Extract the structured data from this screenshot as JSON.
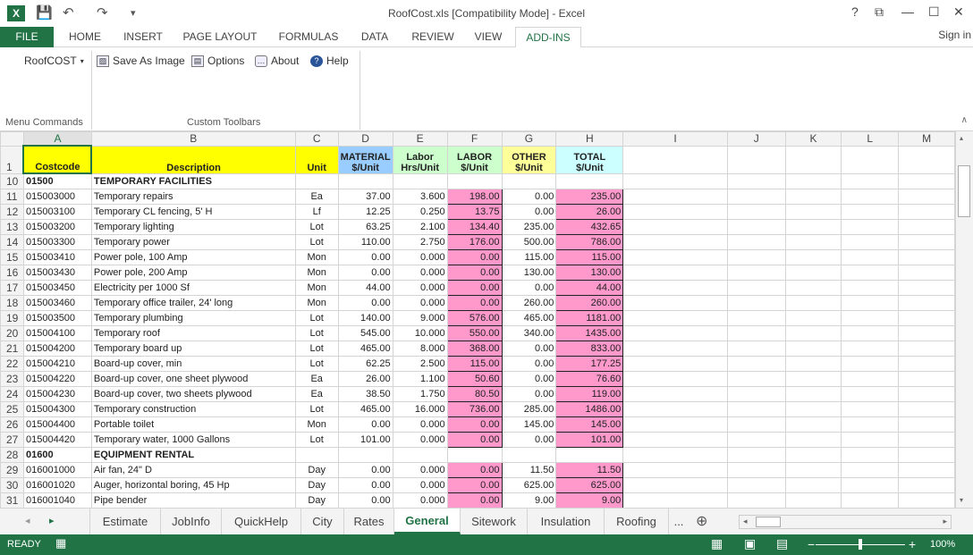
{
  "window": {
    "title": "RoofCost.xls  [Compatibility Mode] - Excel",
    "help": "?",
    "restore": "⧉",
    "minimize": "—",
    "maximize": "☐",
    "close": "✕",
    "app_icon": "X",
    "undo": "↶",
    "redo": "↷",
    "save": "💾",
    "customize": "▾"
  },
  "tabs": [
    "FILE",
    "HOME",
    "INSERT",
    "PAGE LAYOUT",
    "FORMULAS",
    "DATA",
    "REVIEW",
    "VIEW",
    "ADD-INS"
  ],
  "signin": "Sign in",
  "ribbon": {
    "roofcost": "RoofCOST",
    "save_image": "Save As Image",
    "options": "Options",
    "about": "About",
    "help": "Help",
    "menu_commands": "Menu Commands",
    "custom_toolbars": "Custom Toolbars"
  },
  "columns": [
    "A",
    "B",
    "C",
    "D",
    "E",
    "F",
    "G",
    "H",
    "I",
    "J",
    "K",
    "L",
    "M"
  ],
  "header": {
    "row": "1",
    "a": "Costcode",
    "b": "Description",
    "c": "Unit",
    "d1": "MATERIAL",
    "d2": "$/Unit",
    "e1": "Labor",
    "e2": "Hrs/Unit",
    "f1": "LABOR",
    "f2": "$/Unit",
    "g1": "OTHER",
    "g2": "$/Unit",
    "h1": "TOTAL",
    "h2": "$/Unit"
  },
  "rows": [
    {
      "r": "10",
      "a": "01500",
      "b": "TEMPORARY FACILITIES",
      "c": "",
      "d": "",
      "e": "",
      "f": "",
      "g": "",
      "h": "",
      "sec": true
    },
    {
      "r": "11",
      "a": "015003000",
      "b": "Temporary repairs",
      "c": "Ea",
      "d": "37.00",
      "e": "3.600",
      "f": "198.00",
      "g": "0.00",
      "h": "235.00"
    },
    {
      "r": "12",
      "a": "015003100",
      "b": "Temporary CL fencing, 5' H",
      "c": "Lf",
      "d": "12.25",
      "e": "0.250",
      "f": "13.75",
      "g": "0.00",
      "h": "26.00"
    },
    {
      "r": "13",
      "a": "015003200",
      "b": "Temporary lighting",
      "c": "Lot",
      "d": "63.25",
      "e": "2.100",
      "f": "134.40",
      "g": "235.00",
      "h": "432.65"
    },
    {
      "r": "14",
      "a": "015003300",
      "b": "Temporary power",
      "c": "Lot",
      "d": "110.00",
      "e": "2.750",
      "f": "176.00",
      "g": "500.00",
      "h": "786.00"
    },
    {
      "r": "15",
      "a": "015003410",
      "b": "Power pole, 100 Amp",
      "c": "Mon",
      "d": "0.00",
      "e": "0.000",
      "f": "0.00",
      "g": "115.00",
      "h": "115.00"
    },
    {
      "r": "16",
      "a": "015003430",
      "b": "Power pole, 200 Amp",
      "c": "Mon",
      "d": "0.00",
      "e": "0.000",
      "f": "0.00",
      "g": "130.00",
      "h": "130.00"
    },
    {
      "r": "17",
      "a": "015003450",
      "b": "Electricity per 1000 Sf",
      "c": "Mon",
      "d": "44.00",
      "e": "0.000",
      "f": "0.00",
      "g": "0.00",
      "h": "44.00"
    },
    {
      "r": "18",
      "a": "015003460",
      "b": "Temporary office trailer, 24' long",
      "c": "Mon",
      "d": "0.00",
      "e": "0.000",
      "f": "0.00",
      "g": "260.00",
      "h": "260.00"
    },
    {
      "r": "19",
      "a": "015003500",
      "b": "Temporary plumbing",
      "c": "Lot",
      "d": "140.00",
      "e": "9.000",
      "f": "576.00",
      "g": "465.00",
      "h": "1181.00"
    },
    {
      "r": "20",
      "a": "015004100",
      "b": "Temporary roof",
      "c": "Lot",
      "d": "545.00",
      "e": "10.000",
      "f": "550.00",
      "g": "340.00",
      "h": "1435.00"
    },
    {
      "r": "21",
      "a": "015004200",
      "b": "Temporary board up",
      "c": "Lot",
      "d": "465.00",
      "e": "8.000",
      "f": "368.00",
      "g": "0.00",
      "h": "833.00"
    },
    {
      "r": "22",
      "a": "015004210",
      "b": "Board-up cover, min",
      "c": "Lot",
      "d": "62.25",
      "e": "2.500",
      "f": "115.00",
      "g": "0.00",
      "h": "177.25"
    },
    {
      "r": "23",
      "a": "015004220",
      "b": "Board-up cover, one sheet plywood",
      "c": "Ea",
      "d": "26.00",
      "e": "1.100",
      "f": "50.60",
      "g": "0.00",
      "h": "76.60"
    },
    {
      "r": "24",
      "a": "015004230",
      "b": "Board-up cover, two sheets  plywood",
      "c": "Ea",
      "d": "38.50",
      "e": "1.750",
      "f": "80.50",
      "g": "0.00",
      "h": "119.00"
    },
    {
      "r": "25",
      "a": "015004300",
      "b": "Temporary construction",
      "c": "Lot",
      "d": "465.00",
      "e": "16.000",
      "f": "736.00",
      "g": "285.00",
      "h": "1486.00"
    },
    {
      "r": "26",
      "a": "015004400",
      "b": "Portable toilet",
      "c": "Mon",
      "d": "0.00",
      "e": "0.000",
      "f": "0.00",
      "g": "145.00",
      "h": "145.00"
    },
    {
      "r": "27",
      "a": "015004420",
      "b": "Temporary water, 1000 Gallons",
      "c": "Lot",
      "d": "101.00",
      "e": "0.000",
      "f": "0.00",
      "g": "0.00",
      "h": "101.00"
    },
    {
      "r": "28",
      "a": "01600",
      "b": "EQUIPMENT RENTAL",
      "c": "",
      "d": "",
      "e": "",
      "f": "",
      "g": "",
      "h": "",
      "sec": true
    },
    {
      "r": "29",
      "a": "016001000",
      "b": "Air fan, 24\" D",
      "c": "Day",
      "d": "0.00",
      "e": "0.000",
      "f": "0.00",
      "g": "11.50",
      "h": "11.50"
    },
    {
      "r": "30",
      "a": "016001020",
      "b": "Auger, horizontal boring, 45 Hp",
      "c": "Day",
      "d": "0.00",
      "e": "0.000",
      "f": "0.00",
      "g": "625.00",
      "h": "625.00"
    },
    {
      "r": "31",
      "a": "016001040",
      "b": "Pipe bender",
      "c": "Day",
      "d": "0.00",
      "e": "0.000",
      "f": "0.00",
      "g": "9.00",
      "h": "9.00"
    }
  ],
  "sheets": [
    "Estimate",
    "JobInfo",
    "QuickHelp",
    "City",
    "Rates",
    "General",
    "Sitework",
    "Insulation",
    "Roofing",
    "..."
  ],
  "active_sheet": "General",
  "status": {
    "ready": "READY",
    "zoom": "100%",
    "minus": "−",
    "plus": "+",
    "add_sheet": "⊕",
    "prev": "◂",
    "next": "▸",
    "hleft": "◂",
    "hright": "▸",
    "vup": "▴",
    "vdown": "▾",
    "view_normal": "▦",
    "view_layout": "▣",
    "view_break": "▤",
    "macro": "▦"
  }
}
